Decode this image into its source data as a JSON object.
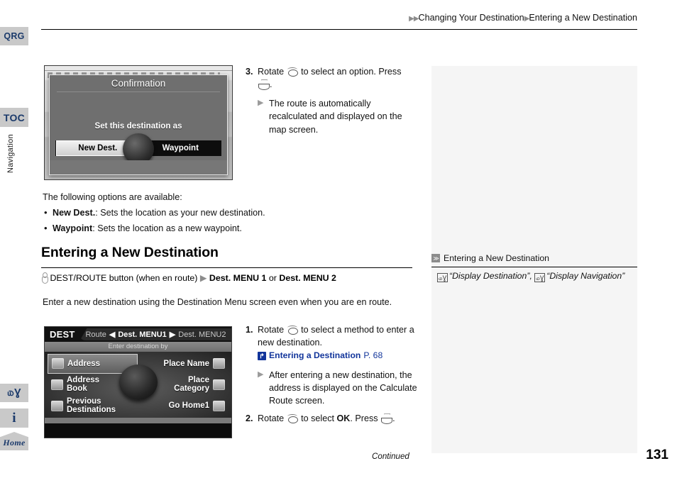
{
  "header": {
    "breadcrumb_arrow_1": "▶▶",
    "breadcrumb_1": "Changing Your Destination",
    "breadcrumb_arrow_2": "▶",
    "breadcrumb_2": "Entering a New Destination"
  },
  "sidebar": {
    "tabs": [
      {
        "label": "QRG",
        "name": "qrg"
      },
      {
        "label": "TOC",
        "name": "toc"
      },
      {
        "label": "Navigation",
        "name": "navigation"
      }
    ],
    "icons": [
      {
        "label": "௰Ɣ",
        "name": "voice-command"
      },
      {
        "label": "i",
        "name": "information"
      },
      {
        "label": "Home",
        "name": "home"
      }
    ]
  },
  "screenshots": {
    "confirmation": {
      "title": "Confirmation",
      "message": "Set this destination as",
      "buttons": [
        {
          "label": "New Dest.",
          "selected": true
        },
        {
          "label": "Waypoint",
          "selected": false
        }
      ]
    },
    "dest_menu": {
      "label": "DEST",
      "tab_route": "Route",
      "arrow_left": "◀",
      "tab_menu1": "Dest. MENU1",
      "arrow_right": "▶",
      "tab_menu2": "Dest. MENU2",
      "subtitle": "Enter destination by",
      "items": [
        {
          "label": "Address",
          "selected": true
        },
        {
          "label": "Place Name",
          "selected": false
        },
        {
          "label": "Address\nBook",
          "selected": false
        },
        {
          "label": "Place\nCategory",
          "selected": false
        },
        {
          "label": "Previous\nDestinations",
          "selected": false
        },
        {
          "label": "Go Home1",
          "selected": false
        }
      ]
    }
  },
  "steps_top": {
    "step3_num": "3.",
    "step3_a": "Rotate",
    "step3_b": "to select an option.",
    "step3_c": "Press",
    "step3_d": ".",
    "result_arrow": "▶",
    "result": "The route is automatically recalculated and displayed on the map screen."
  },
  "options": {
    "intro": "The following options are available:",
    "list": [
      {
        "term": "New Dest.",
        "desc": ": Sets the location as your new destination."
      },
      {
        "term": "Waypoint",
        "desc": ": Sets the location as a new waypoint."
      }
    ]
  },
  "section": {
    "title": "Entering a New Destination",
    "path_a": "DEST/ROUTE button (when en route)",
    "path_arrow": "▶",
    "path_b": "Dest. MENU 1",
    "path_or": "or",
    "path_c": "Dest. MENU 2",
    "intro": "Enter a new destination using the Destination Menu screen even when you are en route."
  },
  "steps_bottom": {
    "step1_num": "1.",
    "step1_a": "Rotate",
    "step1_b": "to select a method to enter a new destination.",
    "xref_icon": "↱",
    "xref_label": "Entering a Destination",
    "xref_page": "P. 68",
    "result_arrow": "▶",
    "result": "After entering a new destination, the address is displayed on the Calculate Route screen.",
    "step2_num": "2.",
    "step2_a": "Rotate",
    "step2_b": "to select",
    "step2_ok": "OK",
    "step2_c": ". Press",
    "step2_d": "."
  },
  "right_panel": {
    "head_icon": "≫",
    "head": "Entering a New Destination",
    "vc_icon": "௰Ɣ",
    "cmd_1": "“Display Destination”",
    "separator": ",",
    "cmd_2": "“Display Navigation”"
  },
  "footer": {
    "continued": "Continued",
    "page_number": "131"
  },
  "colors": {
    "accent_blue": "#12359b",
    "tab_gray": "#c9c9c9",
    "tab_text": "#1b3a6b",
    "panel_bg": "#f5f5f5"
  }
}
